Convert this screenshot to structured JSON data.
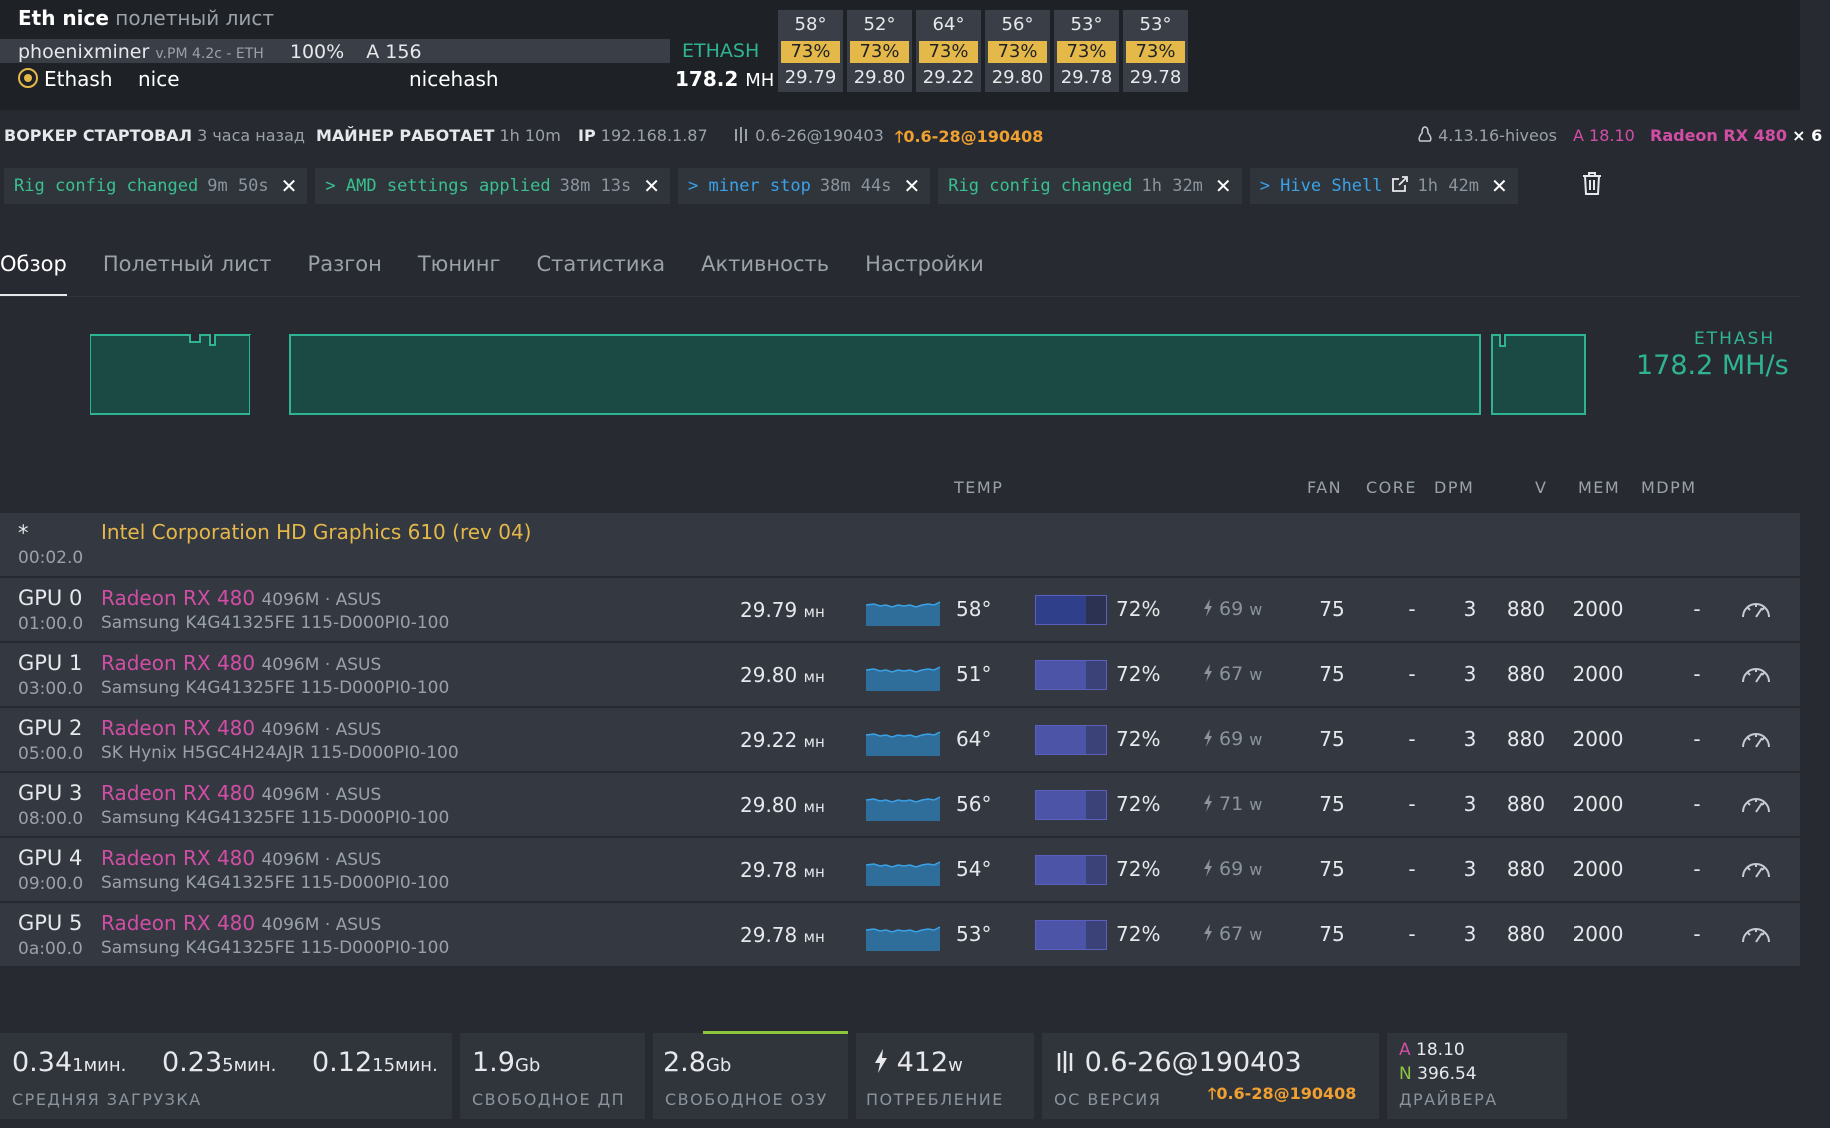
{
  "header": {
    "rig_name": "Eth nice",
    "rig_subtitle": "полетный лист",
    "miner_name": "phoenixminer",
    "miner_version": "v.PM 4.2c - ETH",
    "miner_percent": "100%",
    "miner_accepted": "A 156",
    "algo": "ETHASH",
    "coin": "Ethash",
    "wallet": "nice",
    "pool": "nicehash",
    "hashrate_value": "178.2",
    "hashrate_unit": "MH",
    "gpus": [
      {
        "temp": "58°",
        "fan": "73%",
        "hash": "29.79"
      },
      {
        "temp": "52°",
        "fan": "73%",
        "hash": "29.80"
      },
      {
        "temp": "64°",
        "fan": "73%",
        "hash": "29.22"
      },
      {
        "temp": "56°",
        "fan": "73%",
        "hash": "29.80"
      },
      {
        "temp": "53°",
        "fan": "73%",
        "hash": "29.78"
      },
      {
        "temp": "53°",
        "fan": "73%",
        "hash": "29.78"
      }
    ]
  },
  "info": {
    "worker_label": "ВОРКЕР СТАРТОВАЛ",
    "worker_value": "3 часа назад",
    "miner_label": "МАЙНЕР РАБОТАЕТ",
    "miner_value": "1h 10m",
    "ip_label": "IP",
    "ip_value": "192.168.1.87",
    "os_version": "0.6-26@190403",
    "os_update": "0.6-28@190408",
    "kernel": "4.13.16-hiveos",
    "amd_driver": "A 18.10",
    "gpu_model": "Radeon RX 480",
    "gpu_count": "× 6"
  },
  "events": [
    {
      "text": "Rig config changed",
      "time": "9m 50s",
      "color": "#39c08f"
    },
    {
      "text": "> AMD settings applied",
      "time": "38m 13s",
      "color": "#39c08f"
    },
    {
      "text": "> miner stop",
      "time": "38m 44s",
      "color": "#3aa2e8"
    },
    {
      "text": "Rig config changed",
      "time": "1h 32m",
      "color": "#39c08f"
    },
    {
      "text": "> Hive Shell",
      "time": "1h 42m",
      "color": "#3aa2e8"
    }
  ],
  "tabs": [
    "Обзор",
    "Полетный лист",
    "Разгон",
    "Тюнинг",
    "Статистика",
    "Активность",
    "Настройки"
  ],
  "chart": {
    "algo": "ETHASH",
    "hashrate": "178.2 MH/s"
  },
  "columns": {
    "temp": "TEMP",
    "fan": "FAN",
    "core": "CORE",
    "dpm": "DPM",
    "v": "V",
    "mem": "MEM",
    "mdpm": "MDPM"
  },
  "intel": {
    "index": "*",
    "bus": "00:02.0",
    "name": "Intel Corporation HD Graphics 610 (rev 04)"
  },
  "gpus": [
    {
      "index": "GPU 0",
      "bus": "01:00.0",
      "model": "Radeon RX 480",
      "mem": "4096M · ASUS",
      "sub": "Samsung K4G41325FE 115-D000PI0-100",
      "hash": "29.79",
      "unit": "мн",
      "temp": "58°",
      "fan_pct": "72%",
      "fan_level": 0.72,
      "power": "69",
      "power_unit": "w",
      "fan": "75",
      "core": "-",
      "dpm": "3",
      "v": "880",
      "memclk": "2000",
      "mdpm": "-"
    },
    {
      "index": "GPU 1",
      "bus": "03:00.0",
      "model": "Radeon RX 480",
      "mem": "4096M · ASUS",
      "sub": "Samsung K4G41325FE 115-D000PI0-100",
      "hash": "29.80",
      "unit": "мн",
      "temp": "51°",
      "fan_pct": "72%",
      "fan_level": 0.72,
      "power": "67",
      "power_unit": "w",
      "fan": "75",
      "core": "-",
      "dpm": "3",
      "v": "880",
      "memclk": "2000",
      "mdpm": "-"
    },
    {
      "index": "GPU 2",
      "bus": "05:00.0",
      "model": "Radeon RX 480",
      "mem": "4096M · ASUS",
      "sub": "SK Hynix H5GC4H24AJR 115-D000PI0-100",
      "hash": "29.22",
      "unit": "мн",
      "temp": "64°",
      "fan_pct": "72%",
      "fan_level": 0.72,
      "power": "69",
      "power_unit": "w",
      "fan": "75",
      "core": "-",
      "dpm": "3",
      "v": "880",
      "memclk": "2000",
      "mdpm": "-"
    },
    {
      "index": "GPU 3",
      "bus": "08:00.0",
      "model": "Radeon RX 480",
      "mem": "4096M · ASUS",
      "sub": "Samsung K4G41325FE 115-D000PI0-100",
      "hash": "29.80",
      "unit": "мн",
      "temp": "56°",
      "fan_pct": "72%",
      "fan_level": 0.72,
      "power": "71",
      "power_unit": "w",
      "fan": "75",
      "core": "-",
      "dpm": "3",
      "v": "880",
      "memclk": "2000",
      "mdpm": "-"
    },
    {
      "index": "GPU 4",
      "bus": "09:00.0",
      "model": "Radeon RX 480",
      "mem": "4096M · ASUS",
      "sub": "Samsung K4G41325FE 115-D000PI0-100",
      "hash": "29.78",
      "unit": "мн",
      "temp": "54°",
      "fan_pct": "72%",
      "fan_level": 0.72,
      "power": "69",
      "power_unit": "w",
      "fan": "75",
      "core": "-",
      "dpm": "3",
      "v": "880",
      "memclk": "2000",
      "mdpm": "-"
    },
    {
      "index": "GPU 5",
      "bus": "0a:00.0",
      "model": "Radeon RX 480",
      "mem": "4096M · ASUS",
      "sub": "Samsung K4G41325FE 115-D000PI0-100",
      "hash": "29.78",
      "unit": "мн",
      "temp": "53°",
      "fan_pct": "72%",
      "fan_level": 0.72,
      "power": "67",
      "power_unit": "w",
      "fan": "75",
      "core": "-",
      "dpm": "3",
      "v": "880",
      "memclk": "2000",
      "mdpm": "-"
    }
  ],
  "footer": {
    "load1": "0.34",
    "load1_unit": "1мин.",
    "load5": "0.23",
    "load5_unit": "5мин.",
    "load15": "0.12",
    "load15_unit": "15мин.",
    "load_label": "СРЕДНЯЯ ЗАГРУЗКА",
    "disk": "1.9",
    "disk_unit": "Gb",
    "disk_label": "СВОБОДНОЕ ДП",
    "ram": "2.8",
    "ram_unit": "Gb",
    "ram_label": "СВОБОДНОЕ ОЗУ",
    "power": "412",
    "power_unit": "w",
    "power_label": "ПОТРЕБЛЕНИЕ",
    "os_version": "0.6-26@190403",
    "os_update": "0.6-28@190408",
    "os_label": "ОС ВЕРСИЯ",
    "amd_letter": "A",
    "amd_version": "18.10",
    "nv_letter": "N",
    "nv_version": "396.54",
    "driver_label": "ДРАЙВЕРА"
  },
  "colors": {
    "accent_green": "#2fb493",
    "gpu_pink": "#d24ea6",
    "intel_yellow": "#e5b84a",
    "update_orange": "#f0a030"
  }
}
